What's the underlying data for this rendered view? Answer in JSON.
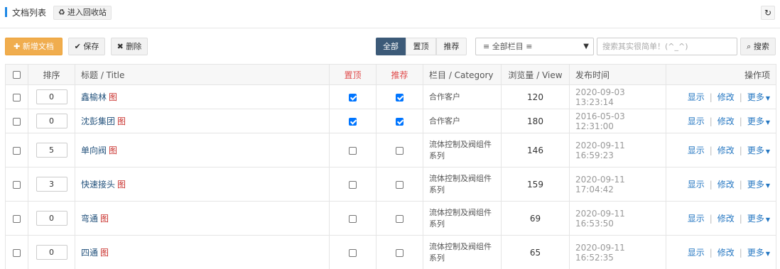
{
  "header": {
    "title": "文档列表",
    "recycle_label": "进入回收站",
    "recycle_icon": "recycle-icon",
    "refresh_icon": "refresh-icon"
  },
  "toolbar": {
    "add_label": "新增文档",
    "save_label": "保存",
    "delete_label": "删除",
    "filters": [
      "全部",
      "置顶",
      "推荐"
    ],
    "active_filter": "全部",
    "category_select": "≡ 全部栏目 ≡",
    "search_placeholder": "搜索其实很简单！(^_^)",
    "search_label": "搜索"
  },
  "colors": {
    "accent": "#3c5a78",
    "add_button": "#f0ad4e",
    "link": "#2577c2",
    "flag_header": "#e04b4b"
  },
  "table": {
    "columns": [
      "排序",
      "标题 / Title",
      "置顶",
      "推荐",
      "栏目 / Category",
      "浏览量 / View",
      "发布时间",
      "操作项"
    ],
    "pic_tag": "图",
    "actions": [
      "显示",
      "修改",
      "更多"
    ],
    "rows": [
      {
        "sort": "0",
        "title": "鑫榆林",
        "top": true,
        "recommend": true,
        "category": "合作客户",
        "views": "120",
        "time": "2020-09-03 13:23:14"
      },
      {
        "sort": "0",
        "title": "沈彭集团",
        "top": true,
        "recommend": true,
        "category": "合作客户",
        "views": "180",
        "time": "2016-05-03 12:31:00"
      },
      {
        "sort": "5",
        "title": "单向阀",
        "top": false,
        "recommend": false,
        "category": "流体控制及阀组件系列",
        "views": "146",
        "time": "2020-09-11 16:59:23"
      },
      {
        "sort": "3",
        "title": "快速接头",
        "top": false,
        "recommend": false,
        "category": "流体控制及阀组件系列",
        "views": "159",
        "time": "2020-09-11 17:04:42"
      },
      {
        "sort": "0",
        "title": "弯通",
        "top": false,
        "recommend": false,
        "category": "流体控制及阀组件系列",
        "views": "69",
        "time": "2020-09-11 16:53:50"
      },
      {
        "sort": "0",
        "title": "四通",
        "top": false,
        "recommend": false,
        "category": "流体控制及阀组件系列",
        "views": "65",
        "time": "2020-09-11 16:52:35"
      }
    ]
  }
}
